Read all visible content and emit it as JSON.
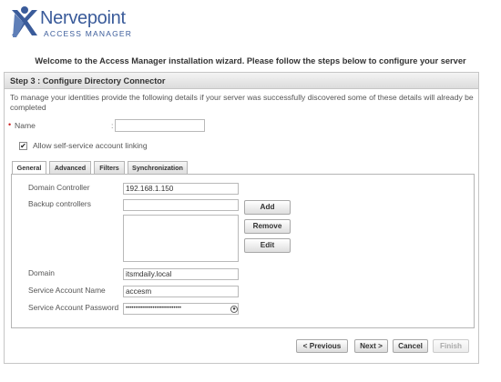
{
  "brand": {
    "name": "Nervepoint",
    "subtitle": "ACCESS MANAGER",
    "accent": "#3a5b9a"
  },
  "welcome": "Welcome to the Access Manager installation wizard. Please follow the steps below to configure your server",
  "step": {
    "title": "Step 3 : Configure Directory Connector",
    "intro": "To manage your identities provide the following details if your server was successfully discovered some of these details will already be completed"
  },
  "name_field": {
    "required_mark": "•",
    "label": "Name",
    "colon": ":",
    "value": ""
  },
  "self_service": {
    "label": "Allow self-service account linking",
    "checked": true,
    "check_glyph": "✔"
  },
  "tabs": [
    {
      "label": "General",
      "active": true
    },
    {
      "label": "Advanced",
      "active": false
    },
    {
      "label": "Filters",
      "active": false
    },
    {
      "label": "Synchronization",
      "active": false
    }
  ],
  "general": {
    "domain_controller": {
      "label": "Domain Controller",
      "value": "192.168.1.150"
    },
    "backup_controllers": {
      "label": "Backup controllers",
      "input_value": ""
    },
    "buttons": {
      "add": "Add",
      "remove": "Remove",
      "edit": "Edit"
    },
    "domain": {
      "label": "Domain",
      "value": "itsmdaily.local"
    },
    "service_account_name": {
      "label": "Service Account Name",
      "value": "accesm"
    },
    "service_account_password": {
      "label": "Service Account Password",
      "value": "•••••••••••••••••••••••••••••",
      "reveal_icon": "eye-icon"
    }
  },
  "nav": {
    "previous": "< Previous",
    "next": "Next >",
    "cancel": "Cancel",
    "finish": "Finish",
    "finish_enabled": false
  }
}
